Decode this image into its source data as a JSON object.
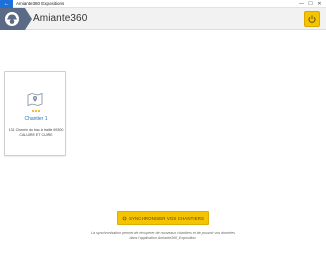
{
  "window": {
    "title": "Amiante360 Expositions",
    "back_glyph": "←",
    "controls": [
      "—",
      "☐",
      "✕"
    ]
  },
  "header": {
    "app_name": "Amiante360",
    "logo_icon": "hard-hat-worker-icon",
    "power_icon": "power-icon",
    "accent": "#f5c400",
    "logo_bg": "#5b6b86"
  },
  "chantiers": [
    {
      "title": "Chantier 1",
      "address": "131 Chemin du bac à traille 69300 CALUIRE ET CUIRE",
      "icon": "map-pin-icon"
    }
  ],
  "sync": {
    "button_label": "SYNCHRONISER VOS CHANTIERS",
    "icon": "sync-icon",
    "note": "La synchronisation permet de récupérer de nouveaux chantiers et de pouvoir vos données dans l'application Amiante360_Exposition."
  }
}
